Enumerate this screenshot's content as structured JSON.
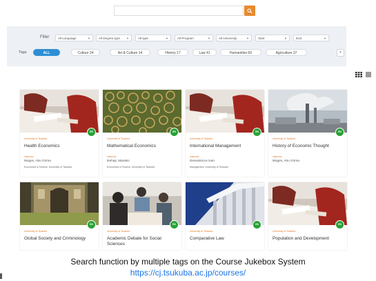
{
  "search": {
    "placeholder": "",
    "button_icon": "search-icon",
    "button_color": "#e68a2e"
  },
  "filters": {
    "label": "Filter",
    "dropdowns": [
      "All-Language",
      "All-Degree type",
      "All-type",
      "All-Program",
      "All-University",
      "Start",
      "End"
    ]
  },
  "tags": {
    "label": "Tags",
    "items": [
      {
        "label": "ALL",
        "active": true
      },
      {
        "label": "Culture  24",
        "active": false
      },
      {
        "label": "Art & Culture  14",
        "active": false
      },
      {
        "label": "History  17",
        "active": false
      },
      {
        "label": "Law  41",
        "active": false
      },
      {
        "label": "Humanities  60",
        "active": false
      },
      {
        "label": "Agriculture  37",
        "active": false
      }
    ],
    "accent": "#2d8fd5"
  },
  "courses": [
    {
      "university": "University of Tsukuba",
      "title": "Health Economics",
      "instructor_label": "Instructor",
      "instructor": "Moges, Abu Girma",
      "more": "Economics & Finance, University of Tsukuba",
      "badge": "EN"
    },
    {
      "university": "University of Tsukuba",
      "title": "Mathematical Economics",
      "instructor_label": "Instructor",
      "instructor": "Ikehaji, Masako",
      "more": "Economics & Finance, University of Tsukuba",
      "badge": "EN"
    },
    {
      "university": "University of Tsukuba",
      "title": "International Management",
      "instructor_label": "Instructor",
      "instructor": "Deseatnicov Ivan",
      "more": "Management, University of Tsukuba",
      "badge": "EN"
    },
    {
      "university": "University of Tsukuba",
      "title": "History of Economic Thought",
      "instructor_label": "Instructor",
      "instructor": "Moges, Abu Girma",
      "more": "",
      "badge": "EN"
    },
    {
      "university": "University of Tsukuba",
      "title": "Global Society and Criminology",
      "badge": "EN"
    },
    {
      "university": "University of Tsukuba",
      "title": "Academic Debate for Social Sciences",
      "badge": "EN"
    },
    {
      "university": "University of Tsukuba",
      "title": "Comparative Law",
      "badge": "EN"
    },
    {
      "university": "University of Tsukuba",
      "title": "Population and Development",
      "badge": "EN"
    }
  ],
  "caption": {
    "text": "Search function by multiple tags on the Course Jukebox System",
    "link": "https://cj.tsukuba.ac.jp/courses/"
  }
}
